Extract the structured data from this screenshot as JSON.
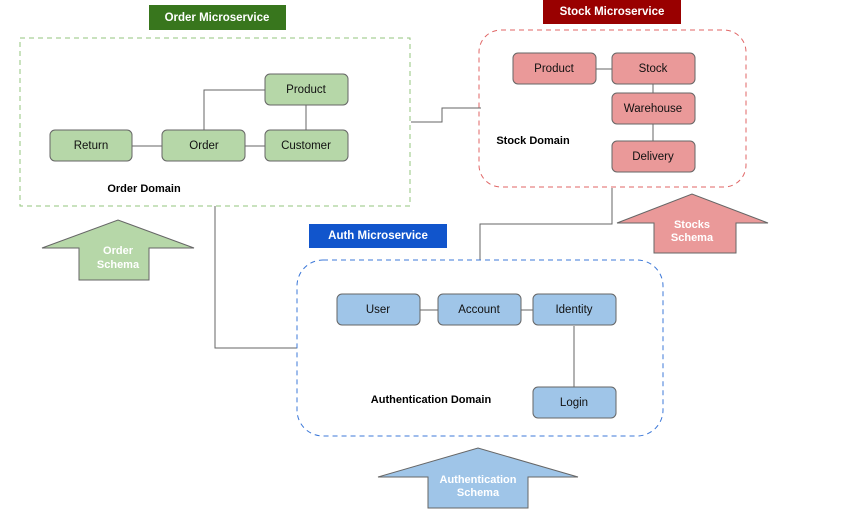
{
  "diagram": {
    "services": {
      "order": {
        "label": "Order Microservice",
        "color": "#38761d"
      },
      "stock": {
        "label": "Stock Microservice",
        "color": "#990000"
      },
      "auth": {
        "label": "Auth Microservice",
        "color": "#1155cc"
      }
    },
    "domains": {
      "order": {
        "label": "Order Domain",
        "border_color": "#93c47d"
      },
      "stock": {
        "label": "Stock Domain",
        "border_color": "#e06666"
      },
      "auth": {
        "label": "Authentication Domain",
        "border_color": "#3c78d8"
      }
    },
    "nodes": {
      "order_product": {
        "label": "Product",
        "fill": "#b6d7a8"
      },
      "order_return": {
        "label": "Return",
        "fill": "#b6d7a8"
      },
      "order_order": {
        "label": "Order",
        "fill": "#b6d7a8"
      },
      "order_customer": {
        "label": "Customer",
        "fill": "#b6d7a8"
      },
      "stock_product": {
        "label": "Product",
        "fill": "#ea9999"
      },
      "stock_stock": {
        "label": "Stock",
        "fill": "#ea9999"
      },
      "stock_warehouse": {
        "label": "Warehouse",
        "fill": "#ea9999"
      },
      "stock_delivery": {
        "label": "Delivery",
        "fill": "#ea9999"
      },
      "auth_user": {
        "label": "User",
        "fill": "#9fc5e8"
      },
      "auth_account": {
        "label": "Account",
        "fill": "#9fc5e8"
      },
      "auth_identity": {
        "label": "Identity",
        "fill": "#9fc5e8"
      },
      "auth_login": {
        "label": "Login",
        "fill": "#9fc5e8"
      }
    },
    "schemas": {
      "order": {
        "line1": "Order",
        "line2": "Schema",
        "fill": "#b6d7a8"
      },
      "stock": {
        "line1": "Stocks",
        "line2": "Schema",
        "fill": "#ea9999"
      },
      "auth": {
        "line1": "Authentication",
        "line2": "Schema",
        "fill": "#9fc5e8"
      }
    },
    "edges": [
      [
        "order_return",
        "order_order"
      ],
      [
        "order_order",
        "order_customer"
      ],
      [
        "order_order",
        "order_product"
      ],
      [
        "order_product",
        "order_customer"
      ],
      [
        "stock_product",
        "stock_stock"
      ],
      [
        "stock_stock",
        "stock_warehouse"
      ],
      [
        "stock_warehouse",
        "stock_delivery"
      ],
      [
        "auth_user",
        "auth_account"
      ],
      [
        "auth_account",
        "auth_identity"
      ],
      [
        "auth_identity",
        "auth_login"
      ],
      [
        "order_domain",
        "stock_domain"
      ],
      [
        "order_domain",
        "auth_domain"
      ],
      [
        "stock_domain",
        "auth_domain"
      ]
    ]
  }
}
